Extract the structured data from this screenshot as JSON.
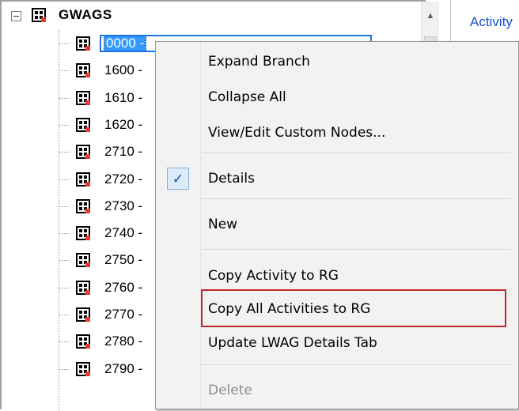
{
  "tree": {
    "root_label": "GWAGS",
    "nodes": [
      {
        "label": "0000 -",
        "selected": true
      },
      {
        "label": "1600 -"
      },
      {
        "label": "1610 -"
      },
      {
        "label": "1620 -"
      },
      {
        "label": "2710 -"
      },
      {
        "label": "2720 -"
      },
      {
        "label": "2730 -"
      },
      {
        "label": "2740 -"
      },
      {
        "label": "2750 -"
      },
      {
        "label": "2760 -"
      },
      {
        "label": "2770 -"
      },
      {
        "label": "2780 -"
      },
      {
        "label": "2790 -"
      }
    ]
  },
  "right_panel": {
    "tab_label": "Activity"
  },
  "context_menu": {
    "items": [
      {
        "label": "Expand Branch"
      },
      {
        "label": "Collapse All"
      },
      {
        "label": "View/Edit Custom Nodes..."
      },
      {
        "label": "Details",
        "checked": true
      },
      {
        "label": "New"
      },
      {
        "label": "Copy Activity to RG"
      },
      {
        "label": "Copy All Activities to RG",
        "highlighted": true
      },
      {
        "label": "Update LWAG Details Tab"
      },
      {
        "label": "Delete",
        "disabled": true
      }
    ],
    "check_glyph": "✓"
  },
  "icons": {
    "node_icon": "activity-node-icon",
    "expander": "collapse-minus-icon",
    "check": "check-icon",
    "scroll_up": "scroll-up-arrow-icon"
  },
  "colors": {
    "selection": "#3399ff",
    "highlight_frame": "#c1272d",
    "tab_text": "#1a4fd0"
  }
}
